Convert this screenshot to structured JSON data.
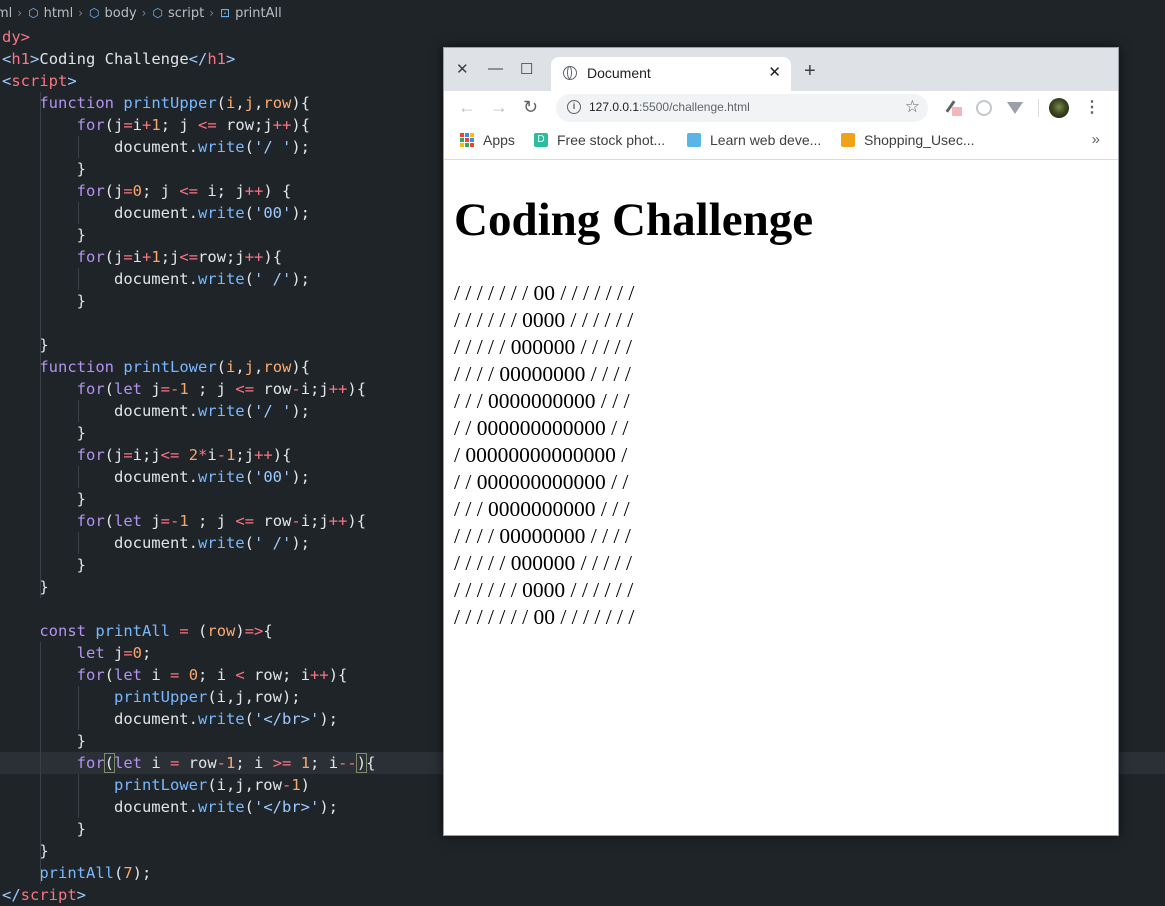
{
  "breadcrumb": {
    "items": [
      "ml",
      "html",
      "body",
      "script",
      "printAll"
    ]
  },
  "editor": {
    "lines": [
      {
        "tokens": [
          [
            "tag",
            "dy>"
          ]
        ]
      },
      {
        "tokens": [
          [
            "pun",
            "<"
          ],
          [
            "tag",
            "h1"
          ],
          [
            "pun",
            ">"
          ],
          [
            "txt",
            "Coding Challenge"
          ],
          [
            "pun",
            "</"
          ],
          [
            "tag",
            "h1"
          ],
          [
            "pun",
            ">"
          ]
        ]
      },
      {
        "tokens": [
          [
            "pun",
            "<"
          ],
          [
            "tag",
            "script"
          ],
          [
            "pun",
            ">"
          ]
        ]
      },
      {
        "tokens": [
          [
            "txt",
            "    "
          ],
          [
            "kw",
            "function"
          ],
          [
            "txt",
            " "
          ],
          [
            "fn",
            "printUpper"
          ],
          [
            "txt",
            "("
          ],
          [
            "par",
            "i"
          ],
          [
            "txt",
            ","
          ],
          [
            "par",
            "j"
          ],
          [
            "txt",
            ","
          ],
          [
            "par",
            "row"
          ],
          [
            "txt",
            "){"
          ]
        ]
      },
      {
        "tokens": [
          [
            "txt",
            "        "
          ],
          [
            "kw",
            "for"
          ],
          [
            "txt",
            "(j"
          ],
          [
            "op",
            "="
          ],
          [
            "txt",
            "i"
          ],
          [
            "op",
            "+"
          ],
          [
            "num",
            "1"
          ],
          [
            "txt",
            "; j "
          ],
          [
            "op",
            "<="
          ],
          [
            "txt",
            " row;j"
          ],
          [
            "op",
            "++"
          ],
          [
            "txt",
            "){"
          ]
        ]
      },
      {
        "tokens": [
          [
            "txt",
            "            document."
          ],
          [
            "fn",
            "write"
          ],
          [
            "txt",
            "("
          ],
          [
            "str",
            "'/ '"
          ],
          [
            "txt",
            ");"
          ]
        ]
      },
      {
        "tokens": [
          [
            "txt",
            "        }"
          ]
        ]
      },
      {
        "tokens": [
          [
            "txt",
            "        "
          ],
          [
            "kw",
            "for"
          ],
          [
            "txt",
            "(j"
          ],
          [
            "op",
            "="
          ],
          [
            "num",
            "0"
          ],
          [
            "txt",
            "; j "
          ],
          [
            "op",
            "<="
          ],
          [
            "txt",
            " i; j"
          ],
          [
            "op",
            "++"
          ],
          [
            "txt",
            ") {"
          ]
        ]
      },
      {
        "tokens": [
          [
            "txt",
            "            document."
          ],
          [
            "fn",
            "write"
          ],
          [
            "txt",
            "("
          ],
          [
            "str",
            "'00'"
          ],
          [
            "txt",
            ");"
          ]
        ]
      },
      {
        "tokens": [
          [
            "txt",
            "        }"
          ]
        ]
      },
      {
        "tokens": [
          [
            "txt",
            "        "
          ],
          [
            "kw",
            "for"
          ],
          [
            "txt",
            "(j"
          ],
          [
            "op",
            "="
          ],
          [
            "txt",
            "i"
          ],
          [
            "op",
            "+"
          ],
          [
            "num",
            "1"
          ],
          [
            "txt",
            ";j"
          ],
          [
            "op",
            "<="
          ],
          [
            "txt",
            "row;j"
          ],
          [
            "op",
            "++"
          ],
          [
            "txt",
            "){"
          ]
        ]
      },
      {
        "tokens": [
          [
            "txt",
            "            document."
          ],
          [
            "fn",
            "write"
          ],
          [
            "txt",
            "("
          ],
          [
            "str",
            "' /'"
          ],
          [
            "txt",
            ");"
          ]
        ]
      },
      {
        "tokens": [
          [
            "txt",
            "        }"
          ]
        ]
      },
      {
        "tokens": [
          [
            "txt",
            ""
          ]
        ]
      },
      {
        "tokens": [
          [
            "txt",
            "    }"
          ]
        ]
      },
      {
        "tokens": [
          [
            "txt",
            "    "
          ],
          [
            "kw",
            "function"
          ],
          [
            "txt",
            " "
          ],
          [
            "fn",
            "printLower"
          ],
          [
            "txt",
            "("
          ],
          [
            "par",
            "i"
          ],
          [
            "txt",
            ","
          ],
          [
            "par",
            "j"
          ],
          [
            "txt",
            ","
          ],
          [
            "par",
            "row"
          ],
          [
            "txt",
            "){"
          ]
        ]
      },
      {
        "tokens": [
          [
            "txt",
            "        "
          ],
          [
            "kw",
            "for"
          ],
          [
            "txt",
            "("
          ],
          [
            "kw",
            "let"
          ],
          [
            "txt",
            " j"
          ],
          [
            "op",
            "=-"
          ],
          [
            "num",
            "1"
          ],
          [
            "txt",
            " ; j "
          ],
          [
            "op",
            "<="
          ],
          [
            "txt",
            " row"
          ],
          [
            "op",
            "-"
          ],
          [
            "txt",
            "i;j"
          ],
          [
            "op",
            "++"
          ],
          [
            "txt",
            "){"
          ]
        ]
      },
      {
        "tokens": [
          [
            "txt",
            "            document."
          ],
          [
            "fn",
            "write"
          ],
          [
            "txt",
            "("
          ],
          [
            "str",
            "'/ '"
          ],
          [
            "txt",
            ");"
          ]
        ]
      },
      {
        "tokens": [
          [
            "txt",
            "        }"
          ]
        ]
      },
      {
        "tokens": [
          [
            "txt",
            "        "
          ],
          [
            "kw",
            "for"
          ],
          [
            "txt",
            "(j"
          ],
          [
            "op",
            "="
          ],
          [
            "txt",
            "i;j"
          ],
          [
            "op",
            "<="
          ],
          [
            "txt",
            " "
          ],
          [
            "num",
            "2"
          ],
          [
            "op",
            "*"
          ],
          [
            "txt",
            "i"
          ],
          [
            "op",
            "-"
          ],
          [
            "num",
            "1"
          ],
          [
            "txt",
            ";j"
          ],
          [
            "op",
            "++"
          ],
          [
            "txt",
            "){"
          ]
        ]
      },
      {
        "tokens": [
          [
            "txt",
            "            document."
          ],
          [
            "fn",
            "write"
          ],
          [
            "txt",
            "("
          ],
          [
            "str",
            "'00'"
          ],
          [
            "txt",
            ");"
          ]
        ]
      },
      {
        "tokens": [
          [
            "txt",
            "        }"
          ]
        ]
      },
      {
        "tokens": [
          [
            "txt",
            "        "
          ],
          [
            "kw",
            "for"
          ],
          [
            "txt",
            "("
          ],
          [
            "kw",
            "let"
          ],
          [
            "txt",
            " j"
          ],
          [
            "op",
            "=-"
          ],
          [
            "num",
            "1"
          ],
          [
            "txt",
            " ; j "
          ],
          [
            "op",
            "<="
          ],
          [
            "txt",
            " row"
          ],
          [
            "op",
            "-"
          ],
          [
            "txt",
            "i;j"
          ],
          [
            "op",
            "++"
          ],
          [
            "txt",
            "){"
          ]
        ]
      },
      {
        "tokens": [
          [
            "txt",
            "            document."
          ],
          [
            "fn",
            "write"
          ],
          [
            "txt",
            "("
          ],
          [
            "str",
            "' /'"
          ],
          [
            "txt",
            ");"
          ]
        ]
      },
      {
        "tokens": [
          [
            "txt",
            "        }"
          ]
        ]
      },
      {
        "tokens": [
          [
            "txt",
            "    }"
          ]
        ]
      },
      {
        "tokens": [
          [
            "txt",
            ""
          ]
        ]
      },
      {
        "tokens": [
          [
            "txt",
            "    "
          ],
          [
            "kw",
            "const"
          ],
          [
            "txt",
            " "
          ],
          [
            "fn",
            "printAll"
          ],
          [
            "txt",
            " "
          ],
          [
            "op",
            "="
          ],
          [
            "txt",
            " ("
          ],
          [
            "par",
            "row"
          ],
          [
            "txt",
            ")"
          ],
          [
            "op",
            "=>"
          ],
          [
            "txt",
            "{"
          ]
        ]
      },
      {
        "tokens": [
          [
            "txt",
            "        "
          ],
          [
            "kw",
            "let"
          ],
          [
            "txt",
            " j"
          ],
          [
            "op",
            "="
          ],
          [
            "num",
            "0"
          ],
          [
            "txt",
            ";"
          ]
        ]
      },
      {
        "tokens": [
          [
            "txt",
            "        "
          ],
          [
            "kw",
            "for"
          ],
          [
            "txt",
            "("
          ],
          [
            "kw",
            "let"
          ],
          [
            "txt",
            " i "
          ],
          [
            "op",
            "="
          ],
          [
            "txt",
            " "
          ],
          [
            "num",
            "0"
          ],
          [
            "txt",
            "; i "
          ],
          [
            "op",
            "<"
          ],
          [
            "txt",
            " row; i"
          ],
          [
            "op",
            "++"
          ],
          [
            "txt",
            "){"
          ]
        ]
      },
      {
        "tokens": [
          [
            "txt",
            "            "
          ],
          [
            "fn",
            "printUpper"
          ],
          [
            "txt",
            "(i,j,row);"
          ]
        ]
      },
      {
        "tokens": [
          [
            "txt",
            "            document."
          ],
          [
            "fn",
            "write"
          ],
          [
            "txt",
            "("
          ],
          [
            "str",
            "'</br>'"
          ],
          [
            "txt",
            ");"
          ]
        ]
      },
      {
        "tokens": [
          [
            "txt",
            "        }"
          ]
        ]
      },
      {
        "tokens": [
          [
            "txt",
            "        "
          ],
          [
            "kw",
            "for"
          ],
          [
            "br",
            "("
          ],
          [
            "kw",
            "let"
          ],
          [
            "txt",
            " i "
          ],
          [
            "op",
            "="
          ],
          [
            "txt",
            " row"
          ],
          [
            "op",
            "-"
          ],
          [
            "num",
            "1"
          ],
          [
            "txt",
            "; i "
          ],
          [
            "op",
            ">="
          ],
          [
            "txt",
            " "
          ],
          [
            "num",
            "1"
          ],
          [
            "txt",
            "; i"
          ],
          [
            "op",
            "--"
          ],
          [
            "br",
            ")"
          ],
          [
            "txt",
            "{"
          ]
        ]
      },
      {
        "tokens": [
          [
            "txt",
            "            "
          ],
          [
            "fn",
            "printLower"
          ],
          [
            "txt",
            "(i,j,row"
          ],
          [
            "op",
            "-"
          ],
          [
            "num",
            "1"
          ],
          [
            "txt",
            ")"
          ]
        ]
      },
      {
        "tokens": [
          [
            "txt",
            "            document."
          ],
          [
            "fn",
            "write"
          ],
          [
            "txt",
            "("
          ],
          [
            "str",
            "'</br>'"
          ],
          [
            "txt",
            ");"
          ]
        ]
      },
      {
        "tokens": [
          [
            "txt",
            "        }"
          ]
        ]
      },
      {
        "tokens": [
          [
            "txt",
            "    }"
          ]
        ]
      },
      {
        "tokens": [
          [
            "txt",
            "    "
          ],
          [
            "fn",
            "printAll"
          ],
          [
            "txt",
            "("
          ],
          [
            "num",
            "7"
          ],
          [
            "txt",
            ");"
          ]
        ]
      },
      {
        "tokens": [
          [
            "pun",
            "</"
          ],
          [
            "tag",
            "script"
          ],
          [
            "pun",
            ">"
          ]
        ]
      }
    ],
    "active_line": 33
  },
  "browser": {
    "tab_title": "Document",
    "new_tab_symbol": "+",
    "url_host": "127.0.0.1",
    "url_path": ":5500/challenge.html",
    "bookmarks": [
      "Apps",
      "Free stock phot...",
      "Learn web deve...",
      "Shopping_Usec..."
    ],
    "bookmarks_more": "»",
    "page": {
      "heading": "Coding Challenge",
      "pattern_lines": [
        "/ / / / / / / 00 / / / / / / /",
        "/ / / / / / 0000 / / / / / /",
        "/ / / / / 000000 / / / / /",
        "/ / / / 00000000 / / / /",
        "/ / / 0000000000 / / /",
        "/ / 000000000000 / /",
        "/ 00000000000000 /",
        "/ / 000000000000 / /",
        "/ / / 0000000000 / / /",
        "/ / / / 00000000 / / / /",
        "/ / / / / 000000 / / / / /",
        "/ / / / / / 0000 / / / / / /",
        "/ / / / / / / 00 / / / / / / /"
      ]
    }
  }
}
